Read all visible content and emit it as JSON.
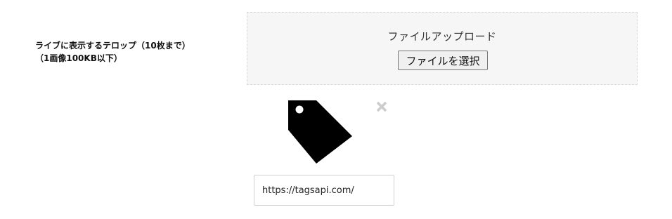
{
  "field": {
    "label_line1": "ライブに表示するテロップ（10枚まで）",
    "label_line2": "（1画像100KB以下）"
  },
  "upload": {
    "title": "ファイルアップロード",
    "choose_button": "ファイルを選択"
  },
  "preview": {
    "image_icon": "tag-icon",
    "remove_icon": "close-icon",
    "remove_color": "#cccccc"
  },
  "link": {
    "value": "https://tagsapi.com/"
  }
}
